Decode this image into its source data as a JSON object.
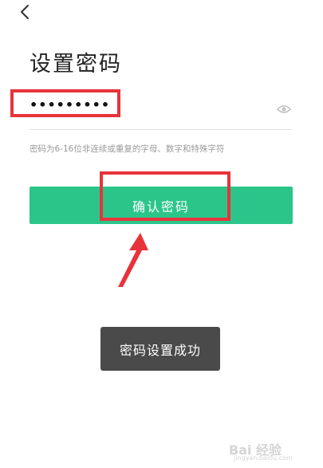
{
  "header": {
    "back_icon": "chevron-left-icon",
    "title": "设置密码"
  },
  "password_field": {
    "value": "•••••••••",
    "toggle_icon": "eye-icon"
  },
  "hint": "密码为6-16位非连续或重复的字母、数字和特殊字符",
  "confirm_button": {
    "label": "确认密码",
    "color": "#2bc58a"
  },
  "toast": {
    "message": "密码设置成功"
  },
  "annotations": {
    "highlight_color": "#e8333a"
  },
  "watermark": {
    "main": "Bai 经验",
    "sub": "jingyan.baidu.com"
  }
}
